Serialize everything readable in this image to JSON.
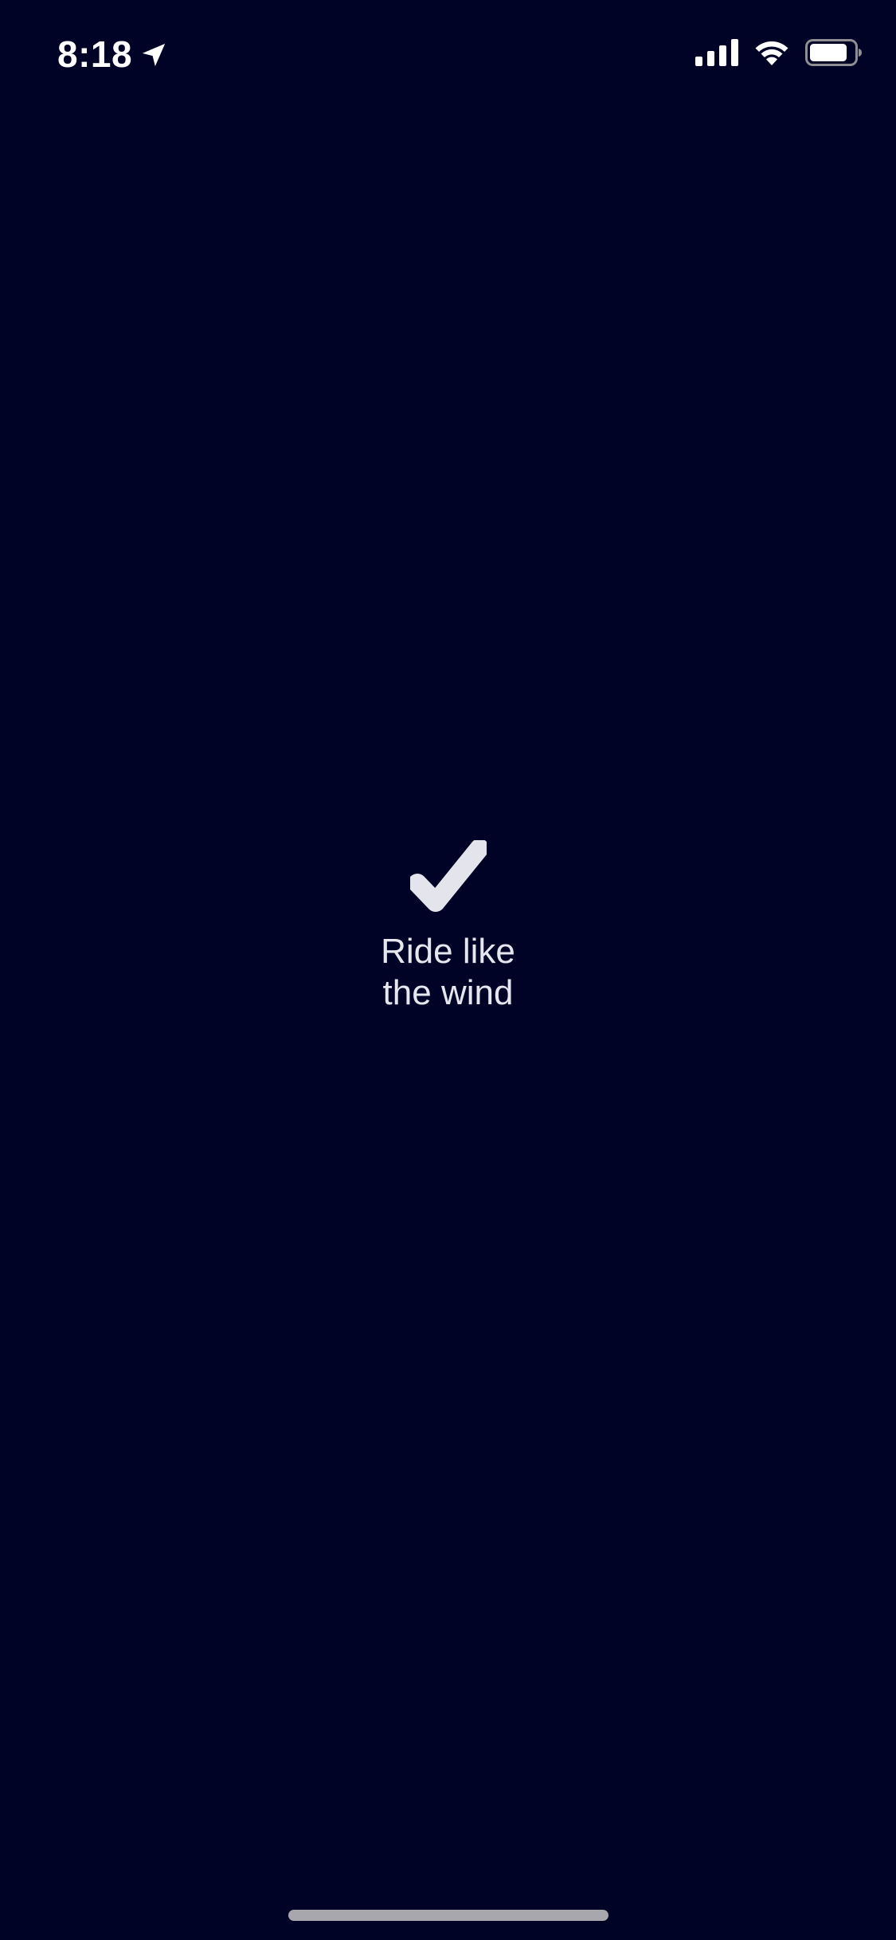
{
  "status_bar": {
    "time": "8:18",
    "icons": [
      "location-arrow-icon",
      "cellular-signal-icon",
      "wifi-icon",
      "battery-icon"
    ]
  },
  "message": {
    "line1": "Ride like",
    "line2": "the wind"
  },
  "icon": "checkmark-icon",
  "colors": {
    "background": "#000226",
    "text": "#e6e6ee",
    "checkmark": "#e4e4ec",
    "home_indicator": "#a7a7ad"
  }
}
